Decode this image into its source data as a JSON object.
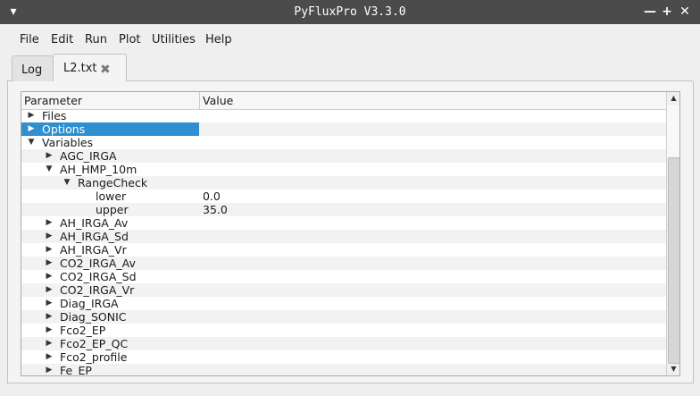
{
  "window": {
    "title": "PyFluxPro V3.3.0",
    "menu_glyph": "▾",
    "minimize_glyph": "—",
    "maximize_glyph": "+",
    "close_glyph": "✕"
  },
  "menu": [
    "File",
    "Edit",
    "Run",
    "Plot",
    "Utilities",
    "Help"
  ],
  "tabs": [
    {
      "label": "Log"
    },
    {
      "label": "L2.txt",
      "close_glyph": "✖"
    }
  ],
  "tree": {
    "headers": {
      "parameter": "Parameter",
      "value": "Value"
    },
    "rows": [
      {
        "name": "Files",
        "value": "",
        "arrow": "▶"
      },
      {
        "name": "Options",
        "value": "",
        "arrow": "▶"
      },
      {
        "name": "Variables",
        "value": "",
        "arrow": "▼"
      },
      {
        "name": "AGC_IRGA",
        "value": "",
        "arrow": "▶"
      },
      {
        "name": "AH_HMP_10m",
        "value": "",
        "arrow": "▼"
      },
      {
        "name": "RangeCheck",
        "value": "",
        "arrow": "▼"
      },
      {
        "name": "lower",
        "value": "0.0",
        "arrow": ""
      },
      {
        "name": "upper",
        "value": "35.0",
        "arrow": ""
      },
      {
        "name": "AH_IRGA_Av",
        "value": "",
        "arrow": "▶"
      },
      {
        "name": "AH_IRGA_Sd",
        "value": "",
        "arrow": "▶"
      },
      {
        "name": "AH_IRGA_Vr",
        "value": "",
        "arrow": "▶"
      },
      {
        "name": "CO2_IRGA_Av",
        "value": "",
        "arrow": "▶"
      },
      {
        "name": "CO2_IRGA_Sd",
        "value": "",
        "arrow": "▶"
      },
      {
        "name": "CO2_IRGA_Vr",
        "value": "",
        "arrow": "▶"
      },
      {
        "name": "Diag_IRGA",
        "value": "",
        "arrow": "▶"
      },
      {
        "name": "Diag_SONIC",
        "value": "",
        "arrow": "▶"
      },
      {
        "name": "Fco2_EP",
        "value": "",
        "arrow": "▶"
      },
      {
        "name": "Fco2_EP_QC",
        "value": "",
        "arrow": "▶"
      },
      {
        "name": "Fco2_profile",
        "value": "",
        "arrow": "▶"
      },
      {
        "name": "Fe_EP",
        "value": "",
        "arrow": "▶"
      }
    ]
  },
  "scrollbar": {
    "up_glyph": "▲",
    "down_glyph": "▼"
  }
}
